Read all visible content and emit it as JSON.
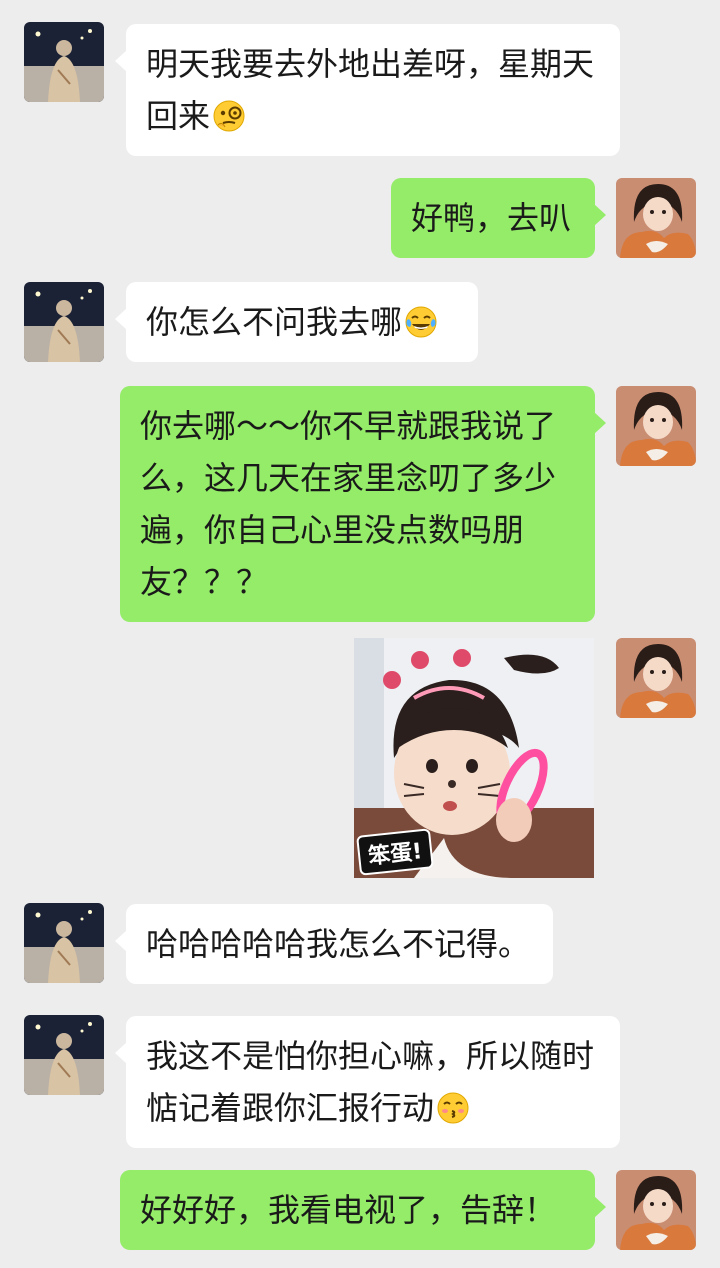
{
  "messages": [
    {
      "side": "in",
      "text": "明天我要去外地出差呀，星期天回来",
      "emoji": "face-with-monocle"
    },
    {
      "side": "out",
      "text": "好鸭，去叭"
    },
    {
      "side": "in",
      "text": "你怎么不问我去哪",
      "emoji": "face-with-tears-of-joy"
    },
    {
      "side": "out",
      "text": "你去哪～～你不早就跟我说了么，这几天在家里念叨了多少遍，你自己心里没点数吗朋友？？？"
    },
    {
      "side": "out",
      "sticker_caption": "笨蛋!"
    },
    {
      "side": "in",
      "text": "哈哈哈哈哈我怎么不记得。"
    },
    {
      "side": "in",
      "text": "我这不是怕你担心嘛，所以随时惦记着跟你汇报行动",
      "emoji": "kissing-face"
    },
    {
      "side": "out",
      "text": "好好好，我看电视了，告辞！"
    }
  ],
  "colors": {
    "background": "#ededed",
    "incoming_bubble": "#ffffff",
    "outgoing_bubble": "#95ec69"
  }
}
